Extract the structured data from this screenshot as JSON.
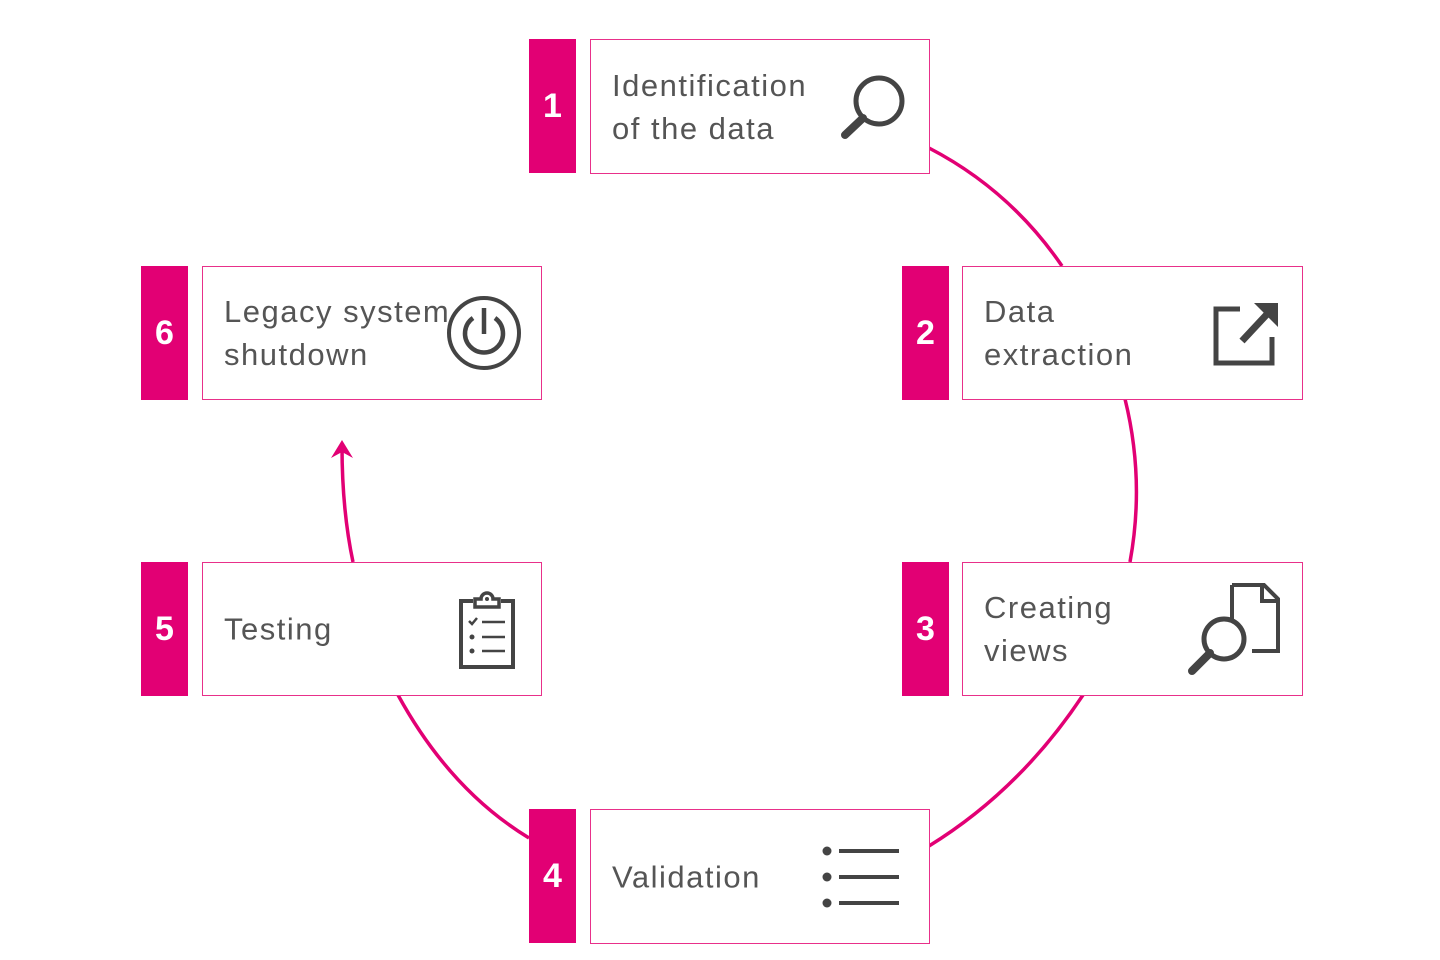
{
  "accent_color": "#e20074",
  "text_color": "#555555",
  "steps": [
    {
      "number": "1",
      "label": "Identification\nof the data",
      "icon": "magnifier-icon"
    },
    {
      "number": "2",
      "label": "Data\nextraction",
      "icon": "external-link-icon"
    },
    {
      "number": "3",
      "label": "Creating\nviews",
      "icon": "document-search-icon"
    },
    {
      "number": "4",
      "label": "Validation",
      "icon": "list-icon"
    },
    {
      "number": "5",
      "label": "Testing",
      "icon": "clipboard-checklist-icon"
    },
    {
      "number": "6",
      "label": "Legacy system\nshutdown",
      "icon": "power-icon"
    }
  ]
}
